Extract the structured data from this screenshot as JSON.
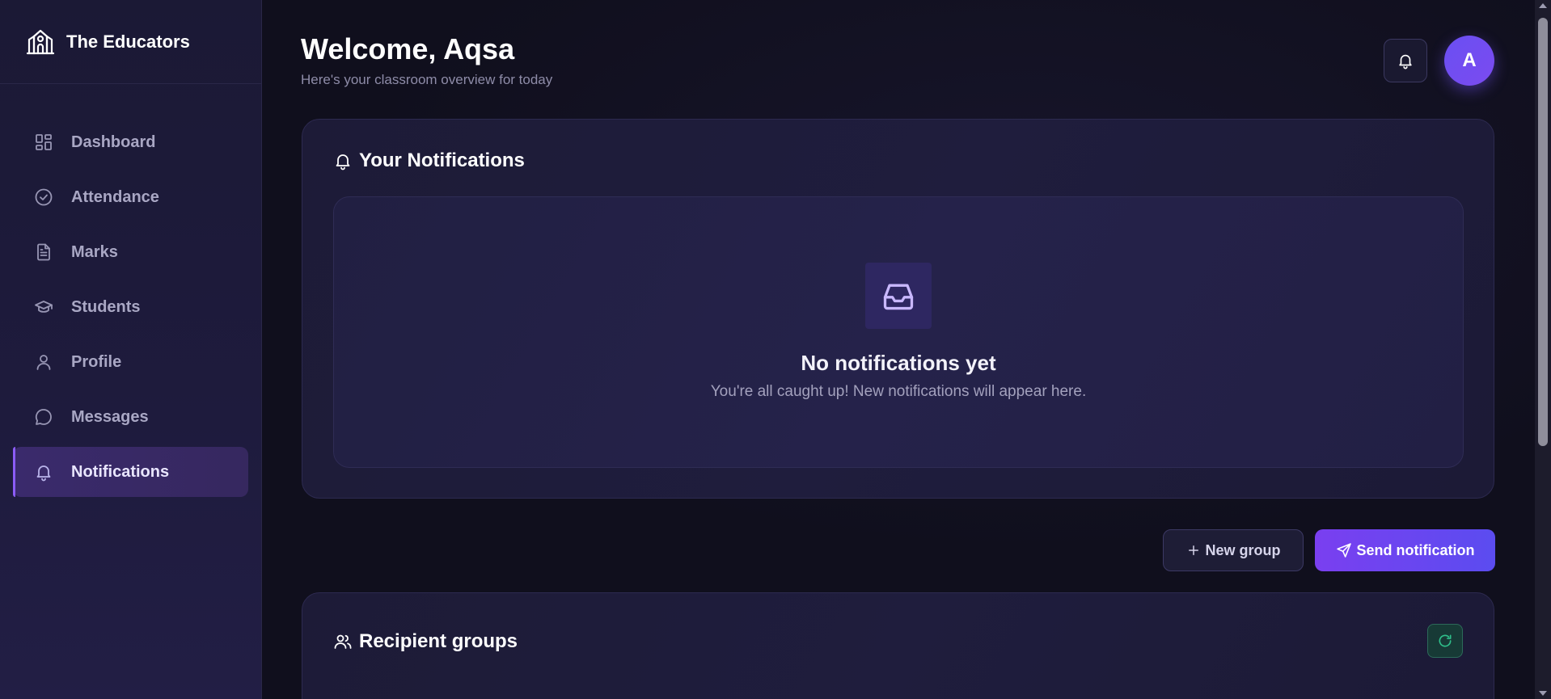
{
  "app": {
    "name": "The Educators"
  },
  "sidebar": {
    "items": [
      {
        "label": "Dashboard",
        "icon": "dashboard-icon"
      },
      {
        "label": "Attendance",
        "icon": "check-circle-icon"
      },
      {
        "label": "Marks",
        "icon": "document-icon"
      },
      {
        "label": "Students",
        "icon": "graduation-cap-icon"
      },
      {
        "label": "Profile",
        "icon": "user-icon"
      },
      {
        "label": "Messages",
        "icon": "chat-bubble-icon"
      },
      {
        "label": "Notifications",
        "icon": "bell-icon",
        "active": true
      }
    ]
  },
  "header": {
    "title": "Welcome, Aqsa",
    "subtitle": "Here's your classroom overview for today",
    "avatar_initial": "A"
  },
  "notifications": {
    "title": "Your Notifications",
    "empty_title": "No notifications yet",
    "empty_subtitle": "You're all caught up! New notifications will appear here."
  },
  "actions": {
    "new_group_label": "New group",
    "send_label": "Send notification"
  },
  "groups": {
    "title": "Recipient groups"
  },
  "colors": {
    "accent": "#7a3ff0",
    "background": "#12111f",
    "sidebar": "#1e1b3d",
    "refresh": "#2fbf8a"
  }
}
